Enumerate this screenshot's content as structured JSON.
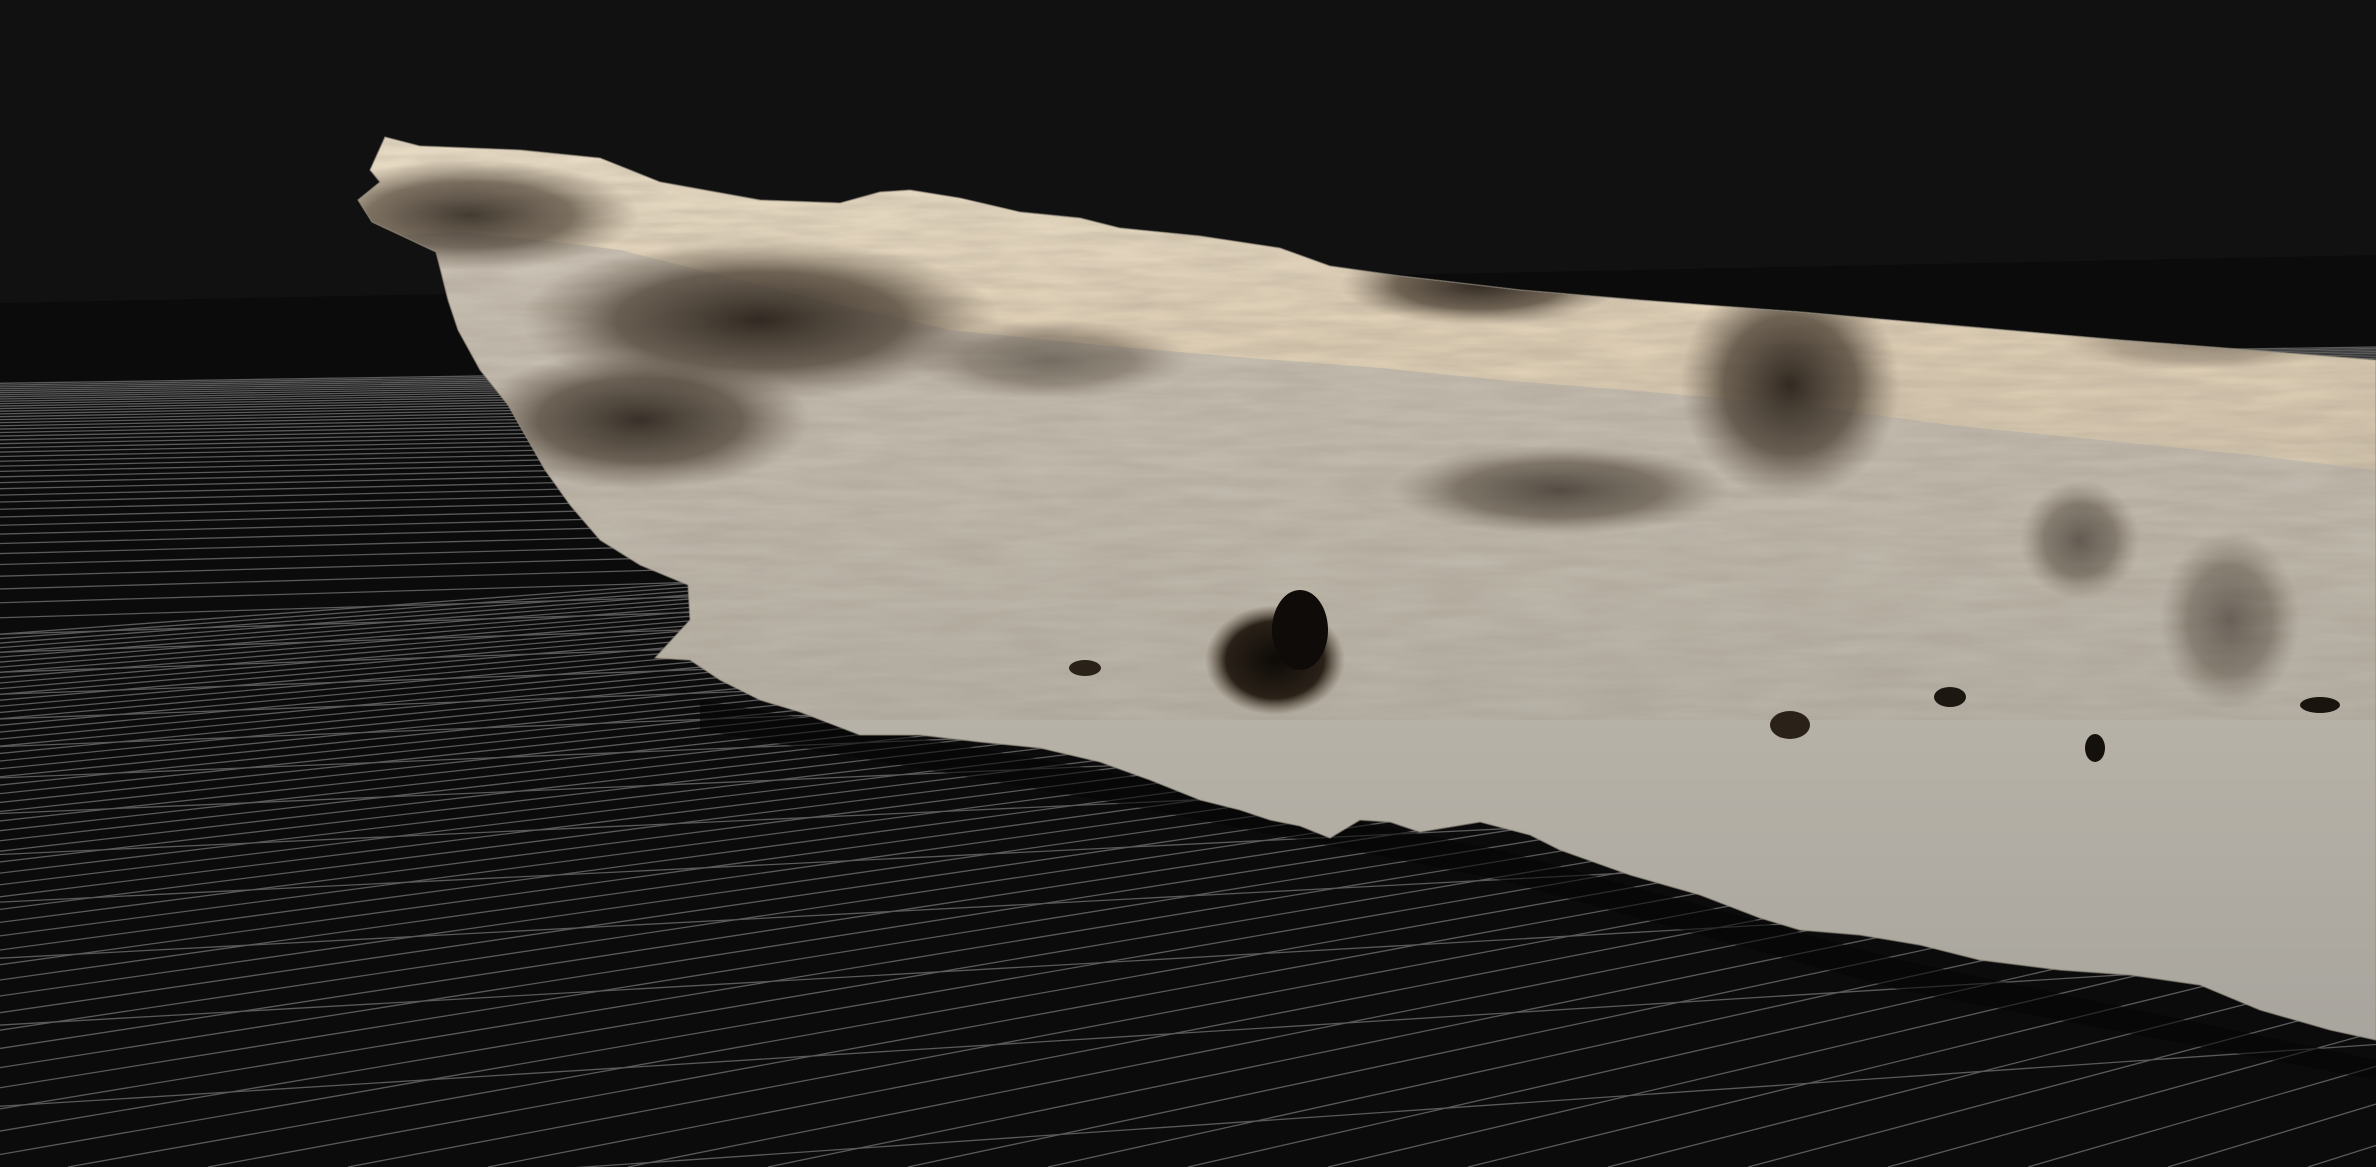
{
  "viewer": {
    "background_color": "#111111",
    "floor_color": "#0b0b0b",
    "grid_line_color": "#5a5a5a",
    "grid_visible": true
  },
  "model": {
    "subject": "driftwood-log-scan",
    "texture_colors": {
      "light_wood": "#e6d6bd",
      "pale_bark": "#cfc6b8",
      "gray_bark": "#a8a59e",
      "dark_rot": "#3a3128",
      "mid_brown": "#6e5d4a",
      "shadow": "#1c1712"
    }
  }
}
